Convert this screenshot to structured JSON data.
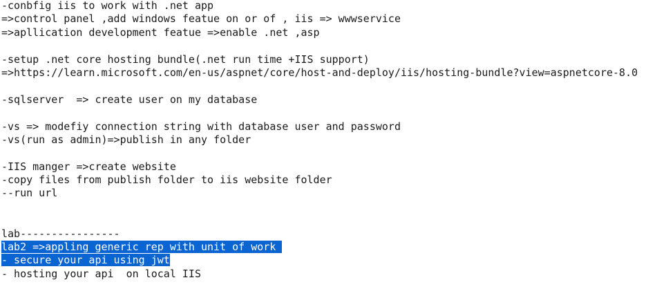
{
  "editor": {
    "lines": {
      "l0": "-conbfig iis to work with .net app",
      "l1": "=>control panel ,add windows featue on or of , iis => wwwservice",
      "l2": "=>apllication development featue =>enable .net ,asp",
      "l3": "",
      "l4": "-setup .net core hosting bundle(.net run time +IIS support)",
      "l5": "=>https://learn.microsoft.com/en-us/aspnet/core/host-and-deploy/iis/hosting-bundle?view=aspnetcore-8.0",
      "l6": "",
      "l7": "-sqlserver  => create user on my database",
      "l8": "",
      "l9": "-vs => modefiy connection string with database user and password",
      "l10": "-vs(run as admin)=>publish in any folder",
      "l11": "",
      "l12": "-IIS manger =>create website",
      "l13": "-copy files from publish folder to iis website folder",
      "l14": "--run url",
      "l15": "",
      "l16": "",
      "l17": "lab----------------",
      "l18": "lab2 =>appling generic rep with unit of work",
      "l19": "- secure your api using jwt",
      "l20": "- hosting your api  on local IIS"
    },
    "selection_color": "#0a64d2"
  }
}
